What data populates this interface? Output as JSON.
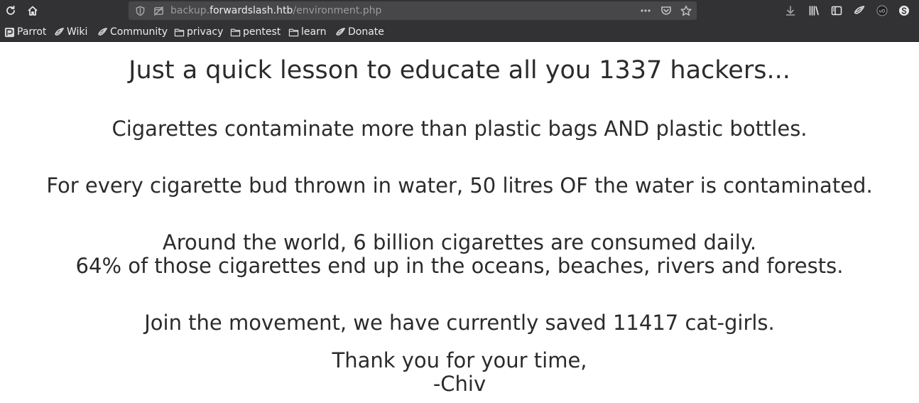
{
  "browser": {
    "url": {
      "subdomain": "backup.",
      "host": "forwardslash.htb",
      "path": "/environment.php"
    },
    "bookmarks": [
      {
        "label": "Parrot",
        "icon": "parrot-icon"
      },
      {
        "label": "Wiki",
        "icon": "parrot-icon"
      },
      {
        "label": "Community",
        "icon": "parrot-icon"
      },
      {
        "label": "privacy",
        "icon": "folder-icon"
      },
      {
        "label": "pentest",
        "icon": "folder-icon"
      },
      {
        "label": "learn",
        "icon": "folder-icon"
      },
      {
        "label": "Donate",
        "icon": "parrot-icon"
      }
    ]
  },
  "page": {
    "heading": "Just a quick lesson to educate all you 1337 hackers...",
    "line1": "Cigarettes contaminate more than plastic bags AND plastic bottles.",
    "line2": "For every cigarette bud thrown in water, 50 litres OF the water is contaminated.",
    "line3a": "Around the world, 6 billion cigarettes are consumed daily.",
    "line3b": "64% of those cigarettes end up in the oceans, beaches, rivers and forests.",
    "line4": "Join the movement, we have currently saved 11417 cat-girls.",
    "closing1": "Thank you for your time,",
    "closing2": "-Chiv"
  }
}
